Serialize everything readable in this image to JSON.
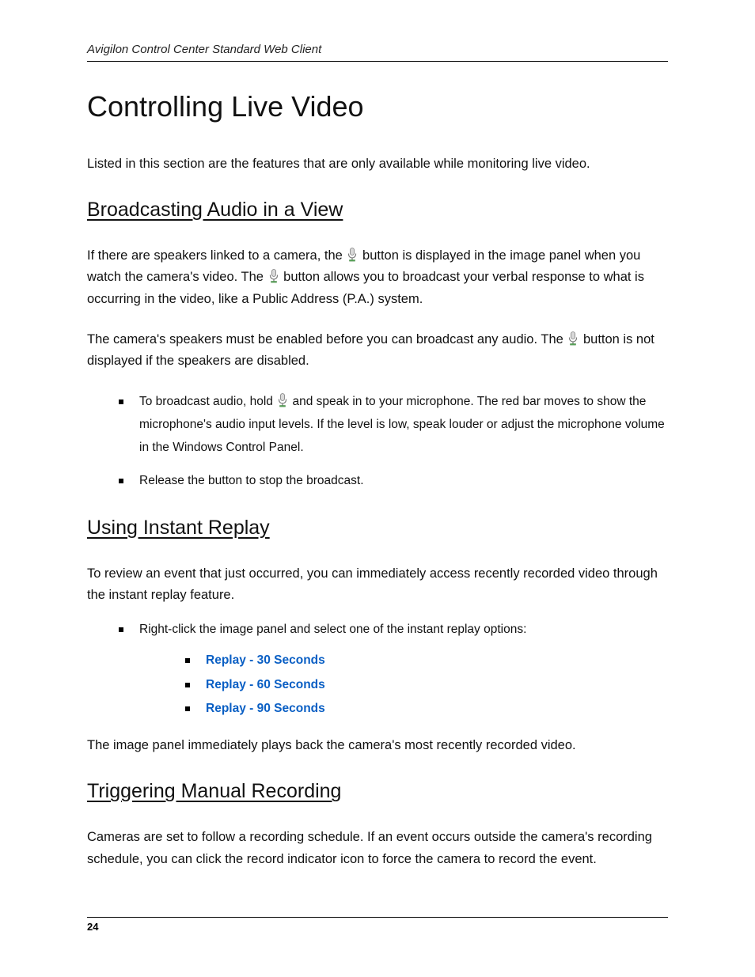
{
  "header": {
    "running_title": "Avigilon Control Center Standard Web Client"
  },
  "title": "Controlling Live Video",
  "intro": "Listed in this section are the features that are only available while monitoring live video.",
  "section1": {
    "heading": "Broadcasting Audio in a View",
    "p1a": "If there are speakers linked to a camera, the ",
    "p1b": " button is displayed in the image panel when you watch the camera's video. The ",
    "p1c": " button allows you to broadcast your verbal response to what is occurring in the video, like a Public Address (P.A.) system.",
    "p2a": "The camera's speakers must be enabled before you can broadcast any audio. The ",
    "p2b": " button is not displayed if the speakers are disabled.",
    "bullet1a": "To broadcast audio, hold ",
    "bullet1b": " and speak in to your microphone. The red bar moves to show the microphone's audio input levels. If the level is low, speak louder or adjust the microphone volume in the Windows Control Panel.",
    "bullet2": "Release the button to stop the broadcast."
  },
  "section2": {
    "heading": "Using Instant Replay",
    "p1": "To review an event that just occurred, you can immediately access recently recorded video through the instant replay feature.",
    "bullet1": "Right-click the image panel and select one of the instant replay options:",
    "options": [
      "Replay - 30 Seconds",
      "Replay - 60 Seconds",
      "Replay - 90 Seconds"
    ],
    "p2": "The image panel immediately plays back the camera's most recently recorded video."
  },
  "section3": {
    "heading": "Triggering Manual Recording",
    "p1": "Cameras are set to follow a recording schedule. If an event occurs outside the camera's recording schedule, you can click the record indicator icon to force the camera to record the event."
  },
  "footer": {
    "page_number": "24"
  }
}
